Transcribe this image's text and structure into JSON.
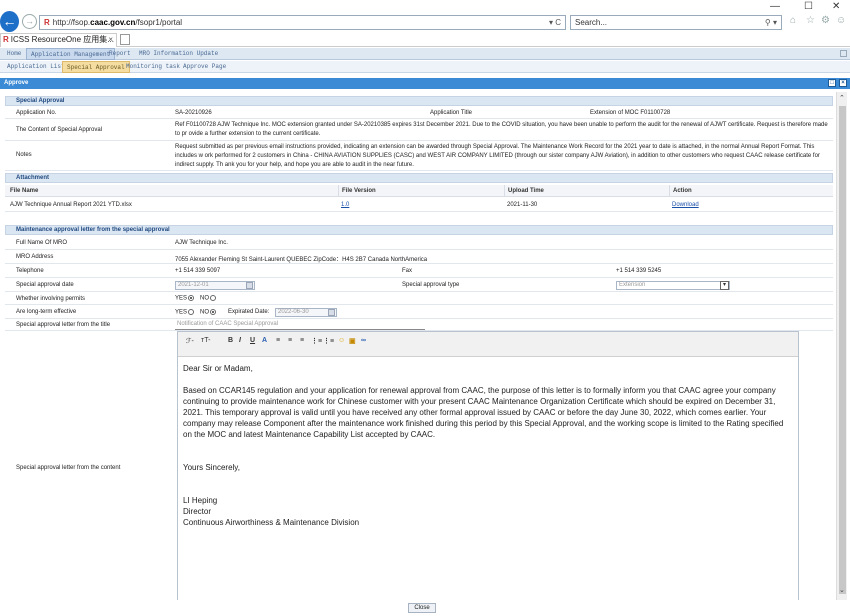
{
  "browser": {
    "url_prefix": "http://fsop.",
    "url_host": "caac.gov.cn",
    "url_path": "/fsopr1/portal",
    "url_controls": "▾ C",
    "search_placeholder": "Search...",
    "search_controls": "⚲ ▾",
    "tab_title": "ICSS ResourceOne 应用集...",
    "tab_close": "×"
  },
  "menu_main": [
    "Home",
    "Application Management",
    "Report",
    "MRO Information Update"
  ],
  "menu_sub": [
    "Application List",
    "Special Approval",
    "Monitoring task",
    "Approve Page"
  ],
  "dialog": {
    "title": "Approve",
    "close_label": "Close"
  },
  "special_approval": {
    "section_title": "Special Approval",
    "app_no_label": "Application No.",
    "app_no_value": "SA-20210926",
    "app_title_label": "Application Title",
    "app_title_value": "Extension of MOC F01100728",
    "content_label": "The Content of Special Approval",
    "content_value": "Ref F01100728 AJW Technique Inc. MOC extension granted under SA-20210385 expires 31st December 2021. Due to the COVID situation, you have been unable to perform the audit for the renewal of AJWT certificate. Request is therefore made to pr ovide a further extension to the current certificate.",
    "notes_label": "Notes",
    "notes_value": "Request submitted as per previous email instructions provided, indicating an extension can be awarded through Special Approval. The Maintenance Work Record for the 2021 year to date is attached, in the normal Annual Report Format. This includes w ork performed for 2 customers in China - CHINA AVIATION SUPPLIES (CASC) and WEST AIR COMPANY LIMITED (through our sister company AJW Aviation), in addition to other customers who request CAAC release certificate for indirect supply. Th ank you for your help, and hope you are able to audit in the near future."
  },
  "attachment": {
    "section_title": "Attachment",
    "headers": [
      "File Name",
      "File Version",
      "Upload Time",
      "Action"
    ],
    "rows": [
      {
        "file_name": "AJW Technique Annual Report 2021 YTD.xlsx",
        "version": "1.0",
        "upload_time": "2021-11-30",
        "action": "Download"
      }
    ]
  },
  "maintenance": {
    "section_title": "Maintenance approval letter from the special approval",
    "mro_name_label": "Full Name Of MRO",
    "mro_name_value": "AJW Technique Inc.",
    "mro_address_label": "MRO Address",
    "mro_address_value": "7055 Alexander Fleming St Saint-Laurent QUEBEC ZipCode：H4S 2B7 Canada NorthAmerica",
    "telephone_label": "Telephone",
    "telephone_value": "+1 514 339 5097",
    "fax_label": "Fax",
    "fax_value": "+1 514 339 5245",
    "sa_date_label": "Special approval date",
    "sa_date_value": "2021-12-01",
    "sa_type_label": "Special approval type",
    "sa_type_value": "Extension",
    "permits_label": "Whether involving permits",
    "yes": "YES",
    "no": "NO",
    "long_term_label": "Are long-term effective",
    "expired_label": "Expirated Date:",
    "expired_value": "2022-06-30",
    "letter_title_label": "Special approval letter from the title",
    "letter_title_value": "Notification of CAAC Special Approval",
    "letter_content_label": "Special approval letter from the content"
  },
  "editor_toolbar": [
    "ℱ-",
    "ᴛT-",
    "B",
    "I",
    "U",
    "A",
    "≡",
    "≡",
    "≡",
    "⋮≡",
    "⋮≡",
    "☺",
    "▣",
    "∞"
  ],
  "letter": {
    "salutation": "Dear Sir or Madam,",
    "body": "Based on CCAR145 regulation and your application for renewal approval from CAAC, the purpose of this letter is to formally inform you that CAAC agree your company continuing to provide maintenance work for Chinese customer with your present CAAC Maintenance Organization Certificate which should be expired on December 31, 2021. This temporary approval is valid until you have received any other formal approval issued by CAAC or before the day June 30, 2022, which comes earlier. Your company may release Component after the maintenance work finished during this period by this Special Approval, and the working scope is limited to the Rating specified on the MOC and latest Maintenance Capability List accepted by CAAC.",
    "closing": "Yours Sincerely,",
    "signer_name": "LI Heping",
    "signer_title": "Director",
    "signer_division": "Continuous Airworthiness & Maintenance Division"
  }
}
